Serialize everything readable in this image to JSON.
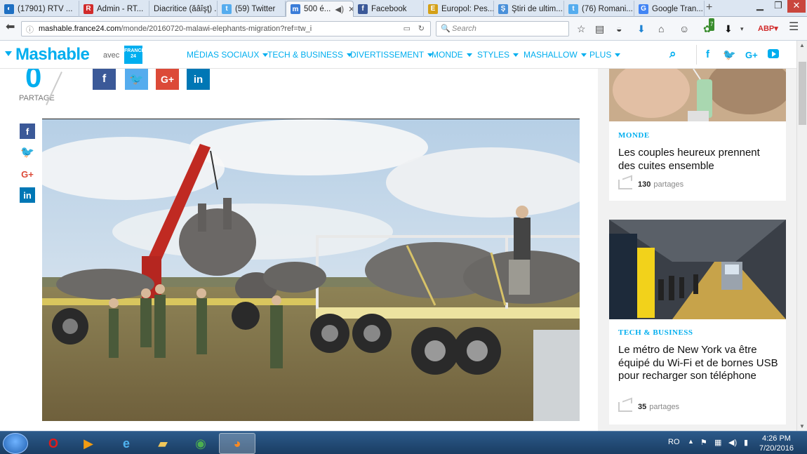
{
  "tabs": [
    {
      "label": "(17901) RTV ...",
      "color": "#1e6fc2",
      "glyph": "◐"
    },
    {
      "label": "Admin - RT...",
      "color": "#d12b2b",
      "glyph": "R"
    },
    {
      "label": "Diacritice (ăâîşţ) ...",
      "color": "#e8e8e8",
      "glyph": ""
    },
    {
      "label": "(59) Twitter",
      "color": "#55acee",
      "glyph": "t"
    },
    {
      "label": "500 é...",
      "color": "#3b7dd8",
      "glyph": "m"
    },
    {
      "label": "Facebook",
      "color": "#3b5998",
      "glyph": "f"
    },
    {
      "label": "Europol: Pes...",
      "color": "#d4a017",
      "glyph": "E"
    },
    {
      "label": "Ştiri de ultim...",
      "color": "#4a90d9",
      "glyph": "Ş"
    },
    {
      "label": "(76) Romani...",
      "color": "#55acee",
      "glyph": "t"
    },
    {
      "label": "Google Tran...",
      "color": "#4285f4",
      "glyph": "G"
    }
  ],
  "browser": {
    "url_host": "mashable.france24.com",
    "url_path": "/monde/20160720-malawi-elephants-migration?ref=tw_i",
    "search_placeholder": "Search",
    "badge_count": "7"
  },
  "site": {
    "logo": "Mashable",
    "avec": "avec",
    "f24": "FRANCE 24",
    "menu": [
      "MÉDIAS SOCIAUX",
      "TECH & BUSINESS",
      "DIVERTISSEMENT",
      "MONDE",
      "STYLES",
      "MASHALLOW",
      "PLUS"
    ]
  },
  "article": {
    "share_count": "0",
    "share_label": "PARTAGE"
  },
  "cards": [
    {
      "category": "MONDE",
      "title": "Les couples heureux prennent des cuites ensemble",
      "shares": "130",
      "shares_label": "partages"
    },
    {
      "category": "TECH & BUSINESS",
      "title": "Le métro de New York va être équipé du Wi-Fi et de bornes USB pour recharger son téléphone",
      "shares": "35",
      "shares_label": "partages"
    }
  ],
  "taskbar": {
    "lang": "RO",
    "time": "4:26 PM",
    "date": "7/20/2016"
  }
}
